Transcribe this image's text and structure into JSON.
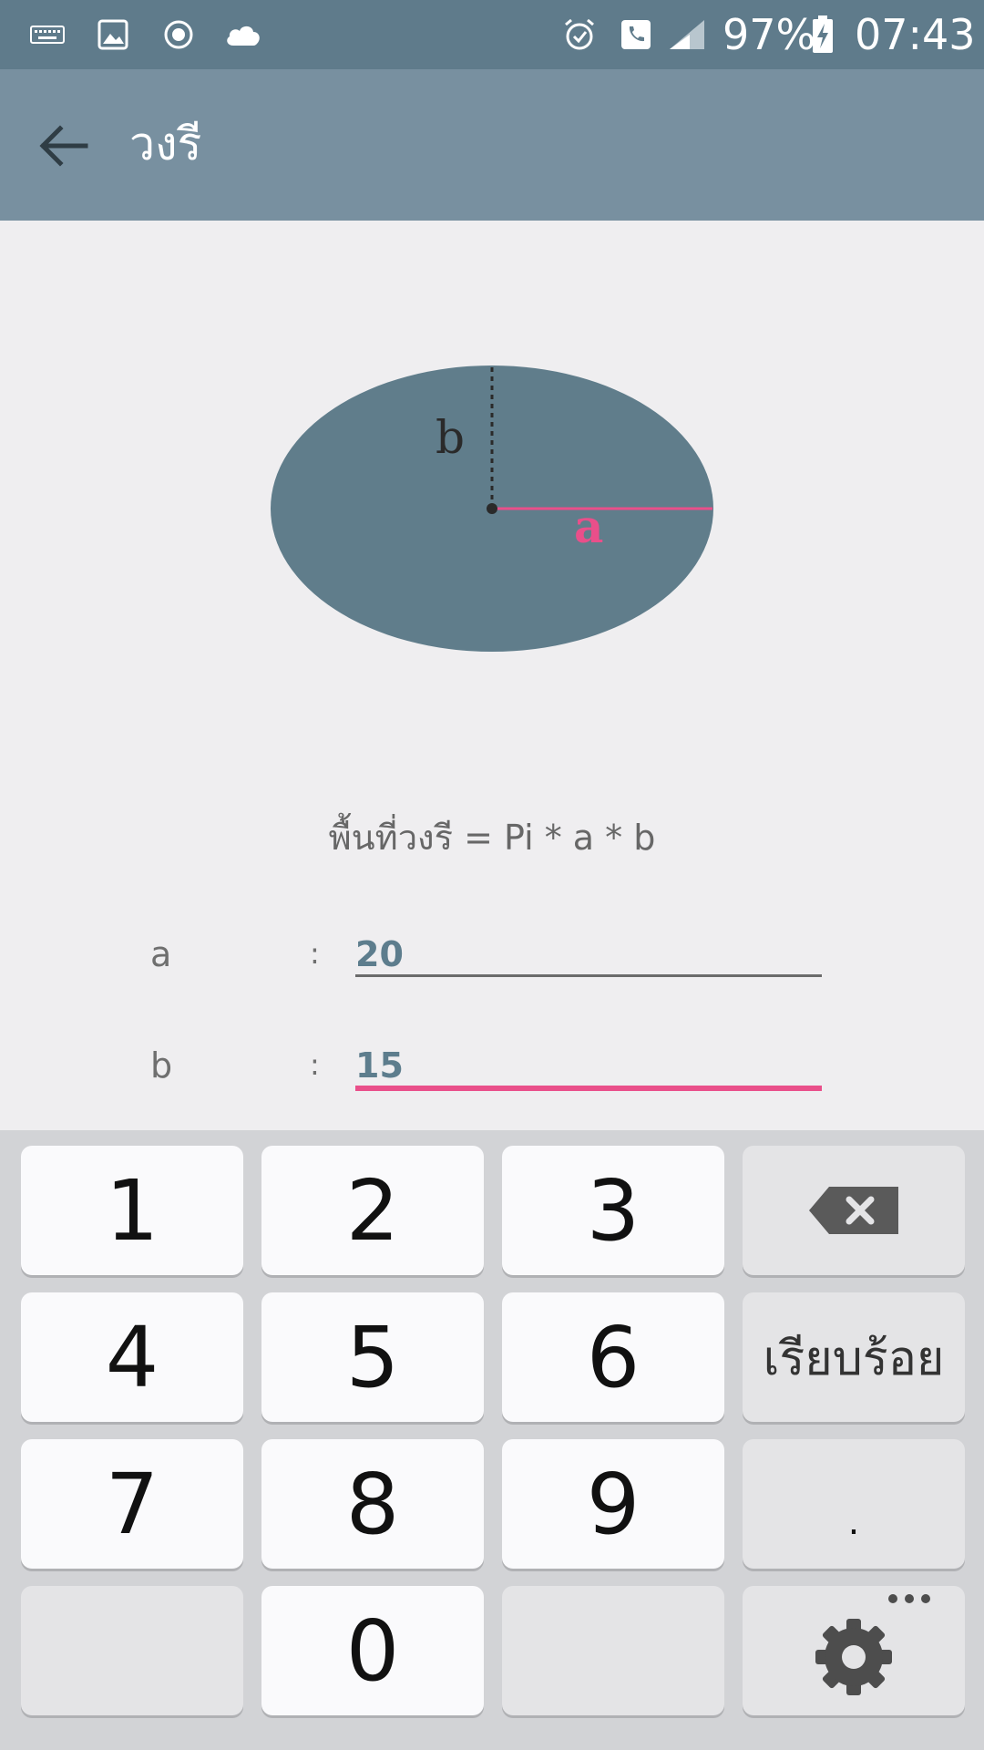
{
  "status_bar": {
    "battery": "97%",
    "time": "07:43",
    "icons": [
      "keyboard-icon",
      "image-icon",
      "record-icon",
      "cloud-icon",
      "alarm-icon",
      "phone-icon",
      "signal-icon",
      "battery-charging-icon"
    ]
  },
  "app_bar": {
    "title": "วงรี",
    "back_icon": "arrow-back-icon"
  },
  "diagram": {
    "label_b": "b",
    "label_a": "a",
    "colors": {
      "ellipse": "#607d8b",
      "accent": "#e94f8a"
    }
  },
  "formula": "พื้นที่วงรี = Pi * a * b",
  "fields": [
    {
      "label": "a",
      "colon": ":",
      "value": "20"
    },
    {
      "label": "b",
      "colon": ":",
      "value": "15"
    }
  ],
  "keyboard": {
    "keys": [
      "1",
      "2",
      "3",
      "4",
      "5",
      "6",
      "7",
      "8",
      "9",
      "0",
      "."
    ],
    "done_label": "เรียบร้อย",
    "backspace_icon": "backspace-icon",
    "settings_icon": "gear-icon"
  },
  "colors": {
    "status_bar": "#5f7b8b",
    "app_bar": "#7890a0",
    "accent": "#e94f8a",
    "input_text": "#5d7d8d"
  }
}
